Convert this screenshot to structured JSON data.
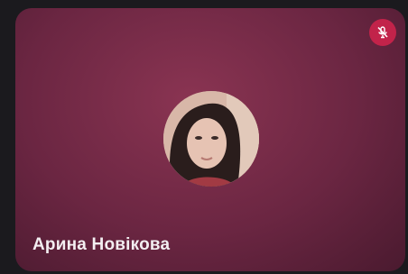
{
  "participant": {
    "name": "Арина Новікова",
    "avatar": "participant-photo",
    "muted": true,
    "status_icon": "microphone-off-icon"
  },
  "colors": {
    "tile_background": "#6b2642",
    "muted_badge": "#c2234a",
    "name_text": "#f3eef1"
  }
}
